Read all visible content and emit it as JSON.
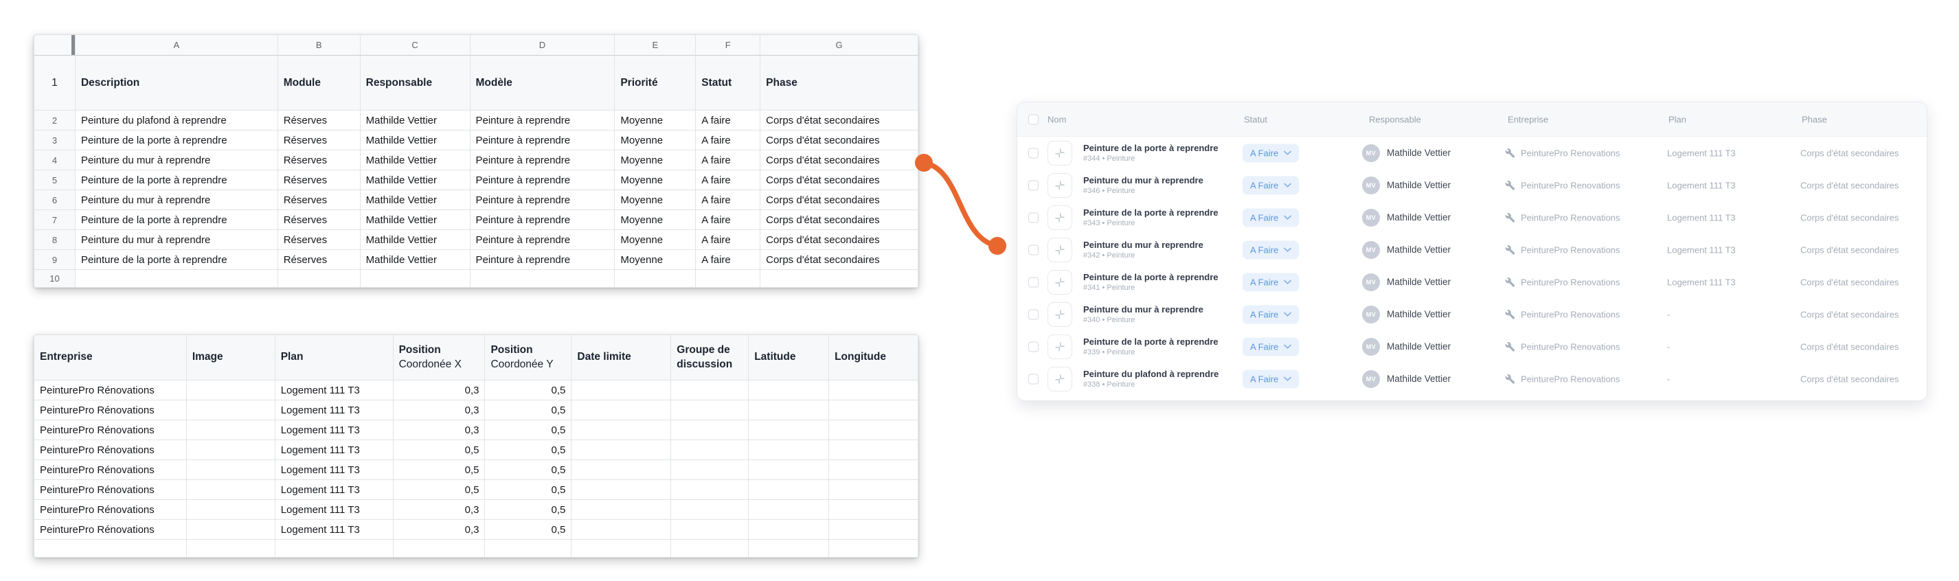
{
  "colors": {
    "accent_orange": "#E8672F",
    "badge_bg": "#E9F1FC",
    "badge_text": "#5A97E8",
    "panel_header_bg": "#F7F8FA"
  },
  "sheet_top": {
    "column_letters": [
      "A",
      "B",
      "C",
      "D",
      "E",
      "F",
      "G"
    ],
    "header_row_number": "1",
    "headers": [
      "Description",
      "Module",
      "Responsable",
      "Modèle",
      "Priorité",
      "Statut",
      "Phase"
    ],
    "rows": [
      {
        "n": "2",
        "cells": [
          "Peinture du plafond à reprendre",
          "Réserves",
          "Mathilde Vettier",
          "Peinture à reprendre",
          "Moyenne",
          "A faire",
          "Corps d'état secondaires"
        ]
      },
      {
        "n": "3",
        "cells": [
          "Peinture de la porte à reprendre",
          "Réserves",
          "Mathilde Vettier",
          "Peinture à reprendre",
          "Moyenne",
          "A faire",
          "Corps d'état secondaires"
        ]
      },
      {
        "n": "4",
        "cells": [
          "Peinture du mur à reprendre",
          "Réserves",
          "Mathilde Vettier",
          "Peinture à reprendre",
          "Moyenne",
          "A faire",
          "Corps d'état secondaires"
        ]
      },
      {
        "n": "5",
        "cells": [
          "Peinture de la porte à reprendre",
          "Réserves",
          "Mathilde Vettier",
          "Peinture à reprendre",
          "Moyenne",
          "A faire",
          "Corps d'état secondaires"
        ]
      },
      {
        "n": "6",
        "cells": [
          "Peinture du mur à reprendre",
          "Réserves",
          "Mathilde Vettier",
          "Peinture à reprendre",
          "Moyenne",
          "A faire",
          "Corps d'état secondaires"
        ]
      },
      {
        "n": "7",
        "cells": [
          "Peinture de la porte à reprendre",
          "Réserves",
          "Mathilde Vettier",
          "Peinture à reprendre",
          "Moyenne",
          "A faire",
          "Corps d'état secondaires"
        ]
      },
      {
        "n": "8",
        "cells": [
          "Peinture du mur à reprendre",
          "Réserves",
          "Mathilde Vettier",
          "Peinture à reprendre",
          "Moyenne",
          "A faire",
          "Corps d'état secondaires"
        ]
      },
      {
        "n": "9",
        "cells": [
          "Peinture de la porte à reprendre",
          "Réserves",
          "Mathilde Vettier",
          "Peinture à reprendre",
          "Moyenne",
          "A faire",
          "Corps d'état secondaires"
        ]
      }
    ],
    "trailing_row_number": "10"
  },
  "sheet_bottom": {
    "headers": {
      "entreprise": "Entreprise",
      "image": "Image",
      "plan": "Plan",
      "position_x_line1": "Position",
      "position_x_line2": "Coordonée X",
      "position_y_line1": "Position",
      "position_y_line2": "Coordonée Y",
      "date_limite": "Date limite",
      "groupe_discussion": "Groupe de discussion",
      "latitude": "Latitude",
      "longitude": "Longitude"
    },
    "rows": [
      [
        "PeinturePro Rénovations",
        "",
        "Logement 111 T3",
        "0,3",
        "0,5",
        "",
        "",
        "",
        ""
      ],
      [
        "PeinturePro Rénovations",
        "",
        "Logement 111 T3",
        "0,3",
        "0,5",
        "",
        "",
        "",
        ""
      ],
      [
        "PeinturePro Rénovations",
        "",
        "Logement 111 T3",
        "0,3",
        "0,5",
        "",
        "",
        "",
        ""
      ],
      [
        "PeinturePro Rénovations",
        "",
        "Logement 111 T3",
        "0,5",
        "0,5",
        "",
        "",
        "",
        ""
      ],
      [
        "PeinturePro Rénovations",
        "",
        "Logement 111 T3",
        "0,5",
        "0,5",
        "",
        "",
        "",
        ""
      ],
      [
        "PeinturePro Rénovations",
        "",
        "Logement 111 T3",
        "0,5",
        "0,5",
        "",
        "",
        "",
        ""
      ],
      [
        "PeinturePro Rénovations",
        "",
        "Logement 111 T3",
        "0,3",
        "0,5",
        "",
        "",
        "",
        ""
      ],
      [
        "PeinturePro Rénovations",
        "",
        "Logement 111 T3",
        "0,3",
        "0,5",
        "",
        "",
        "",
        ""
      ]
    ]
  },
  "task_panel": {
    "columns": [
      "Nom",
      "Statut",
      "Responsable",
      "Entreprise",
      "Plan",
      "Phase"
    ],
    "rows": [
      {
        "name": "Peinture de la porte à reprendre",
        "sub": "#344 • Peinture",
        "status": "A Faire",
        "avatar": "MV",
        "responsable": "Mathilde Vettier",
        "entreprise": "PeinturePro Renovations",
        "plan": "Logement 111 T3",
        "phase": "Corps d'état secondaires"
      },
      {
        "name": "Peinture du mur à reprendre",
        "sub": "#346 • Peinture",
        "status": "A Faire",
        "avatar": "MV",
        "responsable": "Mathilde Vettier",
        "entreprise": "PeinturePro Renovations",
        "plan": "Logement 111 T3",
        "phase": "Corps d'état secondaires"
      },
      {
        "name": "Peinture de la porte à reprendre",
        "sub": "#343 • Peinture",
        "status": "A Faire",
        "avatar": "MV",
        "responsable": "Mathilde Vettier",
        "entreprise": "PeinturePro Renovations",
        "plan": "Logement 111 T3",
        "phase": "Corps d'état secondaires"
      },
      {
        "name": "Peinture du mur à reprendre",
        "sub": "#342 • Peinture",
        "status": "A Faire",
        "avatar": "MV",
        "responsable": "Mathilde Vettier",
        "entreprise": "PeinturePro Renovations",
        "plan": "Logement 111 T3",
        "phase": "Corps d'état secondaires"
      },
      {
        "name": "Peinture de la porte à reprendre",
        "sub": "#341 • Peinture",
        "status": "A Faire",
        "avatar": "MV",
        "responsable": "Mathilde Vettier",
        "entreprise": "PeinturePro Renovations",
        "plan": "Logement 111 T3",
        "phase": "Corps d'état secondaires"
      },
      {
        "name": "Peinture du mur à reprendre",
        "sub": "#340 • Peinture",
        "status": "A Faire",
        "avatar": "MV",
        "responsable": "Mathilde Vettier",
        "entreprise": "PeinturePro Renovations",
        "plan": "-",
        "phase": "Corps d'état secondaires"
      },
      {
        "name": "Peinture de la porte à reprendre",
        "sub": "#339 • Peinture",
        "status": "A Faire",
        "avatar": "MV",
        "responsable": "Mathilde Vettier",
        "entreprise": "PeinturePro Renovations",
        "plan": "-",
        "phase": "Corps d'état secondaires"
      },
      {
        "name": "Peinture du plafond à reprendre",
        "sub": "#338 • Peinture",
        "status": "A Faire",
        "avatar": "MV",
        "responsable": "Mathilde Vettier",
        "entreprise": "PeinturePro Renovations",
        "plan": "-",
        "phase": "Corps d'état secondaires"
      }
    ]
  },
  "connector": {
    "color": "#E8672F"
  }
}
